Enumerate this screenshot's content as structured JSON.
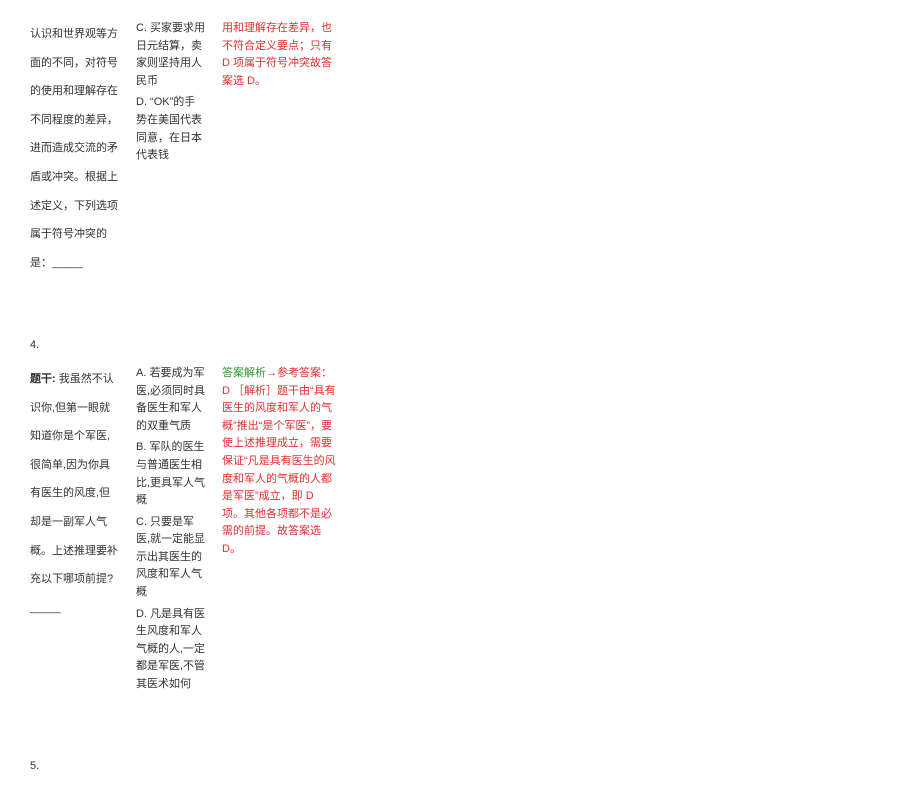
{
  "q3": {
    "stem": "认识和世界观等方面的不同，对符号的使用和理解存在不同程度的差异，进而造成交流的矛盾或冲突。根据上述定义，下列选项属于符号冲突的是：_____",
    "optC": "C. 买家要求用日元结算，卖家则坚持用人民币",
    "optD": "D. “OK”的手势在美国代表同意，在日本代表钱",
    "analysis": "用和理解存在差异，也不符合定义要点；只有 D 项属于符号冲突故答案选 D。"
  },
  "q4": {
    "num": "4.",
    "stemLabel": "题干:",
    "stem": " 我虽然不认识你,但第一眼就知道你是个军医,很简单,因为你具有医生的风度,但却是一副军人气概。上述推理要补充以下哪项前提?_____",
    "optA": "A. 若要成为军医,必须同时具备医生和军人的双重气质",
    "optB": "B. 军队的医生与普通医生相比,更具军人气概",
    "optC": "C. 只要是军医,就一定能显示出其医生的风度和军人气概",
    "optD": "D. 凡是具有医生风度和军人气概的人,一定都是军医,不管其医术如何",
    "ansLabel": "答案解析",
    "ansRef": "→参考答案：D",
    "analysis": "［解析］题干由“具有医生的风度和军人的气概”推出“是个军医”，要使上述推理成立，需要保证“凡是具有医生的风度和军人的气概的人都是军医”成立，即 D 项。其他各项都不是必需的前提。故答案选 D。"
  },
  "q5": {
    "num": "5."
  }
}
